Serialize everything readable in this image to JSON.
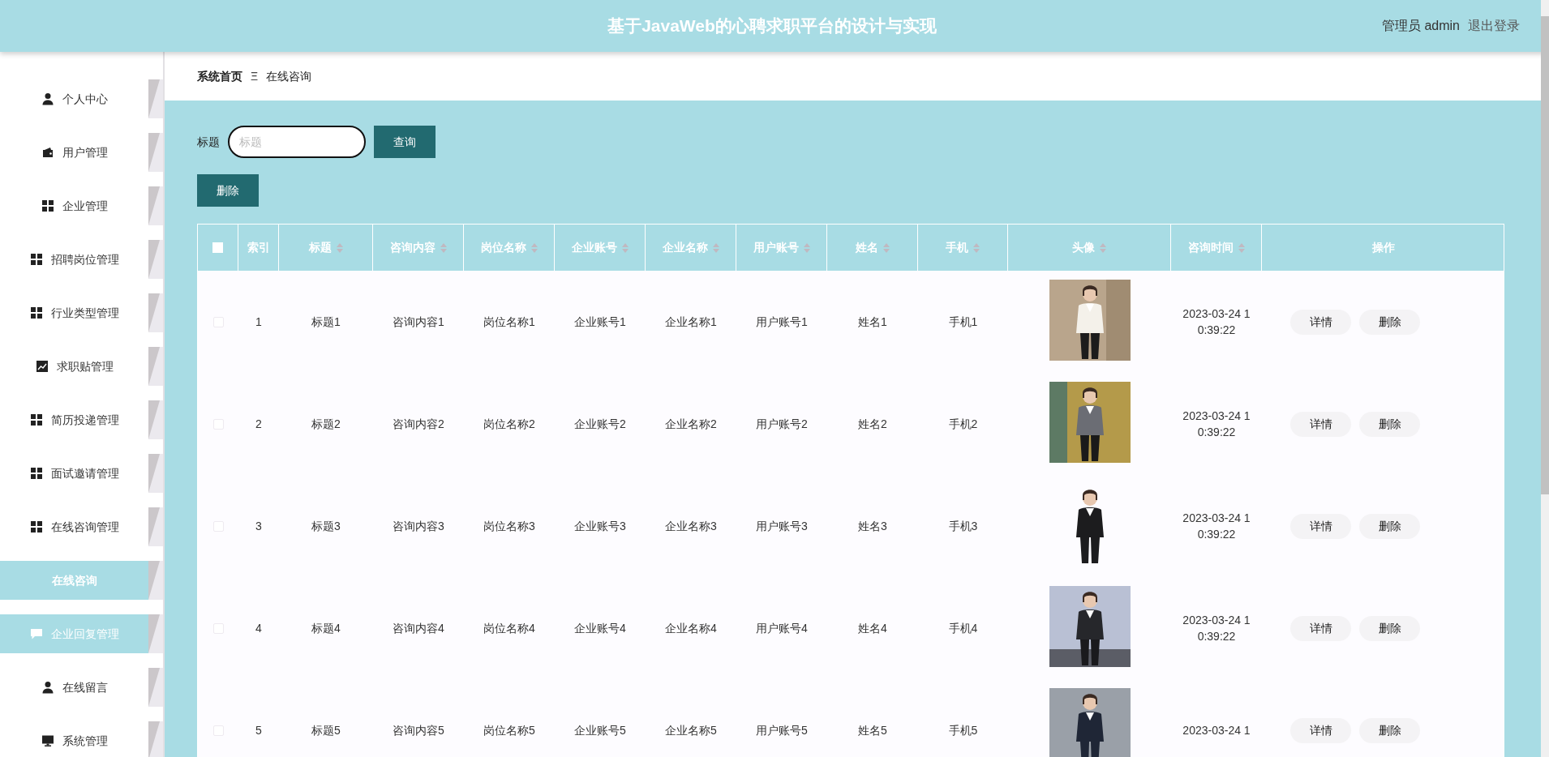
{
  "header": {
    "title": "基于JavaWeb的心聘求职平台的设计与实现",
    "user": "管理员 admin",
    "logout": "退出登录"
  },
  "sidebar": {
    "items": [
      {
        "label": "个人中心",
        "kind": "person",
        "selected": false,
        "hovered": false
      },
      {
        "label": "用户管理",
        "kind": "wallet",
        "selected": false,
        "hovered": false
      },
      {
        "label": "企业管理",
        "kind": "grid",
        "selected": false,
        "hovered": false
      },
      {
        "label": "招聘岗位管理",
        "kind": "grid",
        "selected": false,
        "hovered": false
      },
      {
        "label": "行业类型管理",
        "kind": "grid",
        "selected": false,
        "hovered": false
      },
      {
        "label": "求职贴管理",
        "kind": "chart",
        "selected": false,
        "hovered": false
      },
      {
        "label": "简历投递管理",
        "kind": "grid",
        "selected": false,
        "hovered": false
      },
      {
        "label": "面试邀请管理",
        "kind": "grid",
        "selected": false,
        "hovered": false
      },
      {
        "label": "在线咨询管理",
        "kind": "grid",
        "selected": false,
        "hovered": false
      },
      {
        "label": "在线咨询",
        "kind": "submenu",
        "selected": true,
        "hovered": false
      },
      {
        "label": "企业回复管理",
        "kind": "chat",
        "selected": false,
        "hovered": true
      },
      {
        "label": "在线留言",
        "kind": "person",
        "selected": false,
        "hovered": false
      },
      {
        "label": "系统管理",
        "kind": "monitor",
        "selected": false,
        "hovered": false
      }
    ]
  },
  "breadcrumb": {
    "home": "系统首页",
    "separator": "Ξ",
    "current": "在线咨询"
  },
  "search": {
    "label": "标题",
    "placeholder": "标题",
    "button": "查询"
  },
  "delete_button": "删除",
  "table": {
    "select_all": {
      "checked": false
    },
    "columns": [
      {
        "label": "索引",
        "sortable": false
      },
      {
        "label": "标题",
        "sortable": true
      },
      {
        "label": "咨询内容",
        "sortable": true
      },
      {
        "label": "岗位名称",
        "sortable": true
      },
      {
        "label": "企业账号",
        "sortable": true
      },
      {
        "label": "企业名称",
        "sortable": true
      },
      {
        "label": "用户账号",
        "sortable": true
      },
      {
        "label": "姓名",
        "sortable": true
      },
      {
        "label": "手机",
        "sortable": true
      },
      {
        "label": "头像",
        "sortable": true
      },
      {
        "label": "咨询时间",
        "sortable": true
      },
      {
        "label": "操作",
        "sortable": false
      }
    ],
    "rows": [
      {
        "checked": false,
        "cells": [
          "1",
          "标题1",
          "咨询内容1",
          "岗位名称1",
          "企业账号1",
          "企业名称1",
          "用户账号1",
          "姓名1",
          "手机1"
        ],
        "time": "2023-03-24 10:39:22",
        "actions": [
          "详情",
          "删除"
        ]
      },
      {
        "checked": false,
        "cells": [
          "2",
          "标题2",
          "咨询内容2",
          "岗位名称2",
          "企业账号2",
          "企业名称2",
          "用户账号2",
          "姓名2",
          "手机2"
        ],
        "time": "2023-03-24 10:39:22",
        "actions": [
          "详情",
          "删除"
        ]
      },
      {
        "checked": false,
        "cells": [
          "3",
          "标题3",
          "咨询内容3",
          "岗位名称3",
          "企业账号3",
          "企业名称3",
          "用户账号3",
          "姓名3",
          "手机3"
        ],
        "time": "2023-03-24 10:39:22",
        "actions": [
          "详情",
          "删除"
        ]
      },
      {
        "checked": false,
        "cells": [
          "4",
          "标题4",
          "咨询内容4",
          "岗位名称4",
          "企业账号4",
          "企业名称4",
          "用户账号4",
          "姓名4",
          "手机4"
        ],
        "time": "2023-03-24 10:39:22",
        "actions": [
          "详情",
          "删除"
        ]
      },
      {
        "checked": false,
        "cells": [
          "5",
          "标题5",
          "咨询内容5",
          "岗位名称5",
          "企业账号5",
          "企业名称5",
          "用户账号5",
          "姓名5",
          "手机5"
        ],
        "time": "2023-03-24 1",
        "actions": [
          "详情",
          "删除"
        ]
      }
    ]
  }
}
